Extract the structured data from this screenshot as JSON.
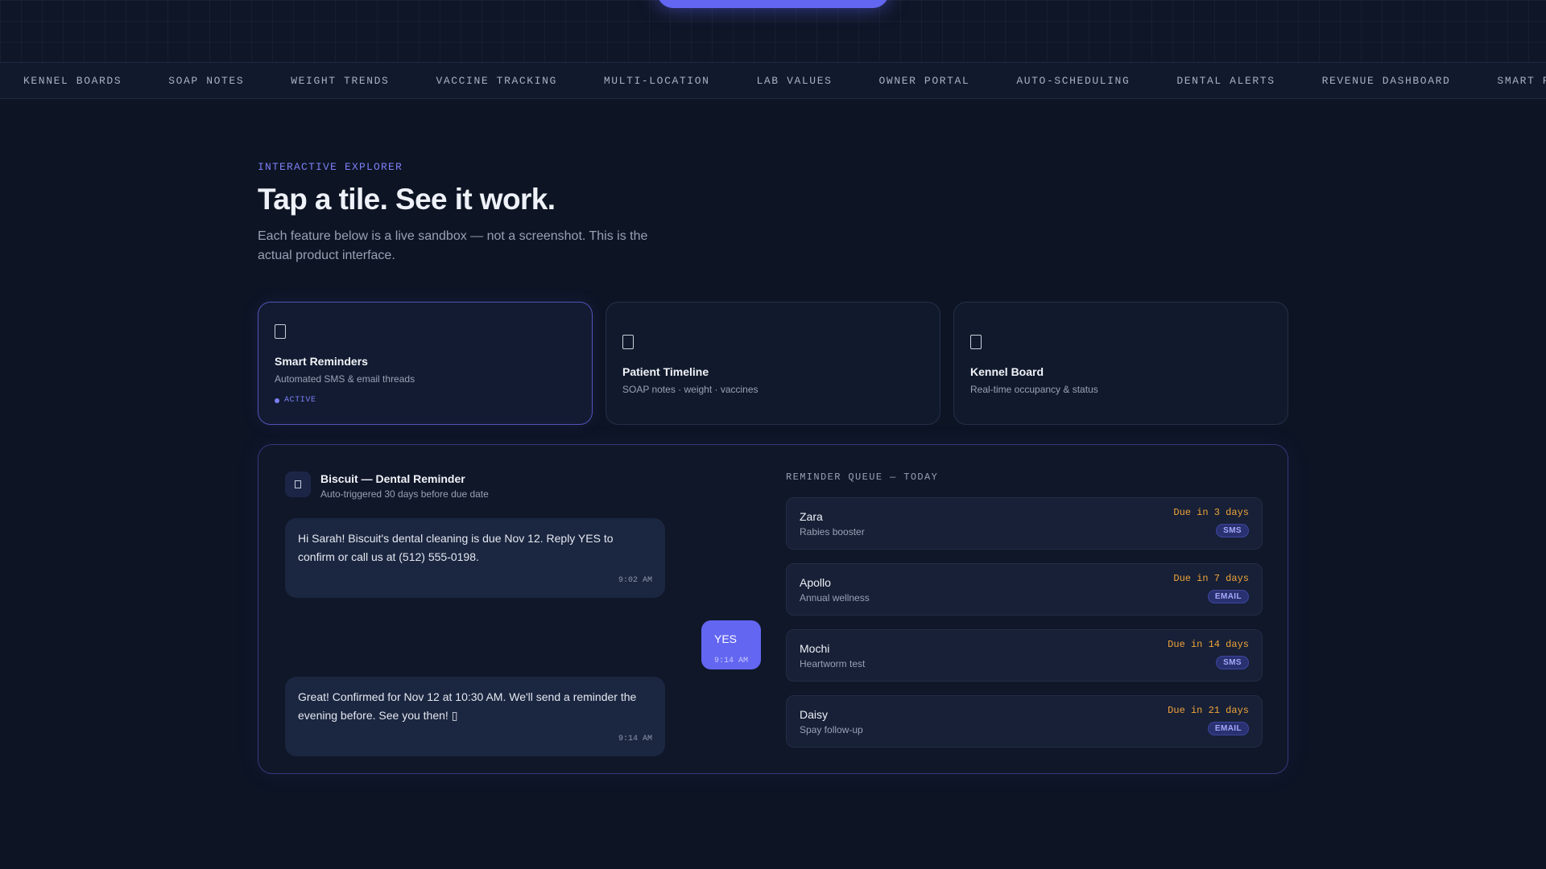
{
  "ticker": [
    "KENNEL BOARDS",
    "SOAP NOTES",
    "WEIGHT TRENDS",
    "VACCINE TRACKING",
    "MULTI-LOCATION",
    "LAB VALUES",
    "OWNER PORTAL",
    "AUTO-SCHEDULING",
    "DENTAL ALERTS",
    "REVENUE DASHBOARD",
    "SMART REMINDERS"
  ],
  "hero": {
    "eyebrow": "INTERACTIVE EXPLORER",
    "title": "Tap a tile. See it work.",
    "subtitle": "Each feature below is a live sandbox — not a screenshot. This is the actual product interface."
  },
  "tiles": [
    {
      "title": "Smart Reminders",
      "desc": "Automated SMS & email threads",
      "status": "ACTIVE",
      "icon": "bell-icon"
    },
    {
      "title": "Patient Timeline",
      "desc": "SOAP notes · weight · vaccines",
      "icon": "clipboard-icon"
    },
    {
      "title": "Kennel Board",
      "desc": "Real-time occupancy & status",
      "icon": "kennel-icon"
    }
  ],
  "chat": {
    "title": "Biscuit — Dental Reminder",
    "subtitle": "Auto-triggered 30 days before due date",
    "messages": [
      {
        "from": "clinic",
        "text": "Hi Sarah! Biscuit's dental cleaning is due Nov 12. Reply YES to confirm or call us at (512) 555-0198.",
        "time": "9:02 AM"
      },
      {
        "from": "owner",
        "text": "YES",
        "time": "9:14 AM"
      },
      {
        "from": "clinic",
        "text": "Great! Confirmed for Nov 12 at 10:30 AM. We'll send a reminder the evening before. See you then! ▯",
        "time": "9:14 AM"
      }
    ]
  },
  "queue": {
    "label": "REMINDER QUEUE — TODAY",
    "items": [
      {
        "name": "Zara",
        "desc": "Rabies booster",
        "due": "Due in 3 days",
        "channel": "SMS"
      },
      {
        "name": "Apollo",
        "desc": "Annual wellness",
        "due": "Due in 7 days",
        "channel": "EMAIL"
      },
      {
        "name": "Mochi",
        "desc": "Heartworm test",
        "due": "Due in 14 days",
        "channel": "SMS"
      },
      {
        "name": "Daisy",
        "desc": "Spay follow-up",
        "due": "Due in 21 days",
        "channel": "EMAIL"
      }
    ]
  },
  "colors": {
    "accent": "#6366f1",
    "due": "#f0a43a",
    "background": "#0d1424"
  }
}
